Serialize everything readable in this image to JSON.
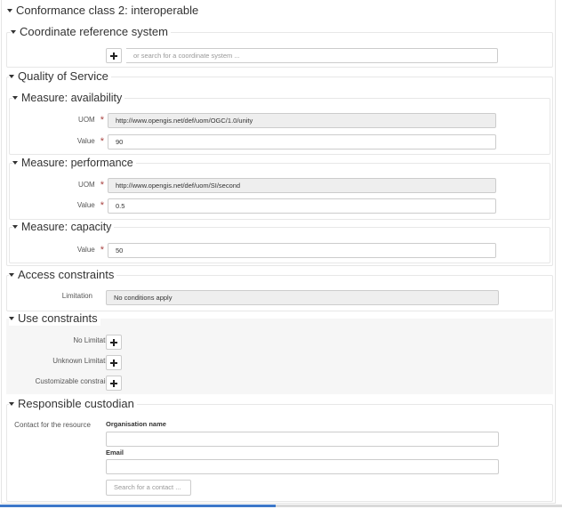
{
  "conformance": {
    "title": "Conformance class 2: interoperable"
  },
  "crs": {
    "title": "Coordinate reference system",
    "search_placeholder": "or search for a coordinate system ..."
  },
  "qos": {
    "title": "Quality of Service",
    "availability": {
      "title": "Measure: availability",
      "uom_label": "UOM",
      "uom_value": "http://www.opengis.net/def/uom/OGC/1.0/unity",
      "value_label": "Value",
      "value": "90"
    },
    "performance": {
      "title": "Measure: performance",
      "uom_label": "UOM",
      "uom_value": "http://www.opengis.net/def/uom/SI/second",
      "value_label": "Value",
      "value": "0.5"
    },
    "capacity": {
      "title": "Measure: capacity",
      "value_label": "Value",
      "value": "50"
    }
  },
  "access": {
    "title": "Access constraints",
    "limitation_label": "Limitation",
    "limitation_value": "No conditions apply"
  },
  "use": {
    "title": "Use constraints",
    "no_limitation_label": "No Limitation",
    "unknown_limitation_label": "Unknown Limitation",
    "customizable_label": "Customizable constraints"
  },
  "custodian": {
    "title": "Responsible custodian",
    "contact_label": "Contact for the resource",
    "org_label": "Organisation name",
    "org_value": "",
    "email_label": "Email",
    "email_value": "",
    "search_contact_placeholder": "Search for a contact ..."
  },
  "colors": {
    "required": "#a94442",
    "readonly_bg": "#eeeeee",
    "scrollbar": "#3d78c9"
  }
}
